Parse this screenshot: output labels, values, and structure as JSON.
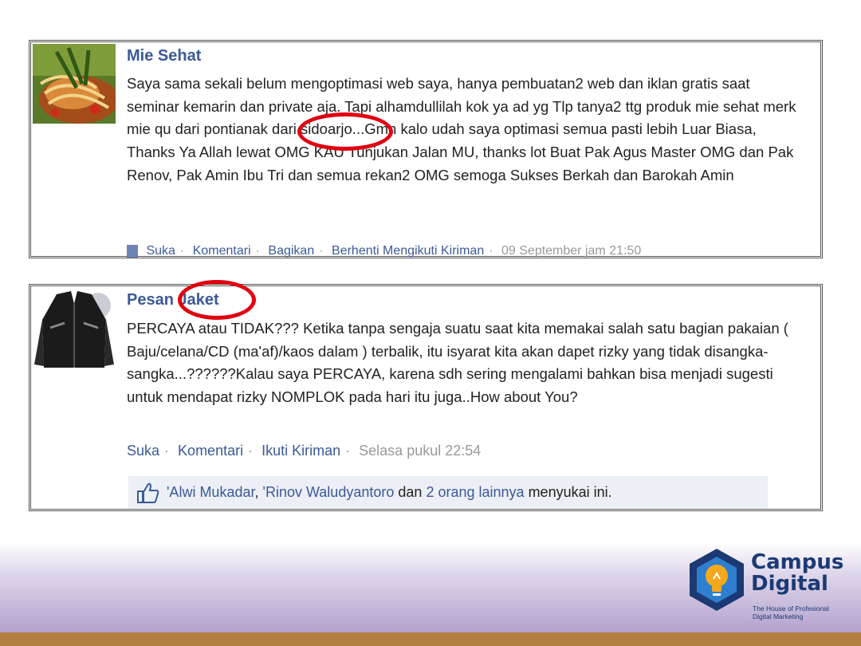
{
  "colors": {
    "link": "#3b5998",
    "annotation": "#e00010",
    "brand_blue": "#1b3a74",
    "brand_orange": "#f4a81d",
    "footer_bar": "#b07e3e"
  },
  "post1": {
    "author": "Mie Sehat",
    "avatar_icon": "noodle-photo",
    "body": "Saya sama sekali belum mengoptimasi web saya, hanya pembuatan2 web dan iklan gratis saat seminar kemarin dan private aja. Tapi alhamdullilah kok ya ad yg Tlp tanya2 ttg produk mie sehat merk mie qu dari pontianak dari sidoarjo...Gmn kalo udah saya optimasi semua pasti lebih Luar Biasa, Thanks Ya Allah lewat OMG KAU Tunjukan Jalan MU, thanks lot Buat Pak Agus Master OMG dan Pak Renov, Pak Amin Ibu Tri dan semua rekan2 OMG semoga Sukses Berkah dan Barokah Amin",
    "actions": {
      "like": "Suka",
      "comment": "Komentari",
      "share": "Bagikan",
      "follow": "Berhenti Mengikuti Kiriman",
      "time": "09 September jam 21:50"
    }
  },
  "post2": {
    "author": "Pesan Jaket",
    "avatar_icon": "jacket-photo",
    "body": "PERCAYA atau TIDAK??? Ketika tanpa sengaja suatu saat kita memakai salah satu bagian pakaian ( Baju/celana/CD (ma'af)/kaos dalam ) terbalik, itu isyarat kita akan dapet rizky yang tidak disangka-sangka...??????Kalau saya PERCAYA, karena sdh sering mengalami bahkan bisa menjadi sugesti untuk mendapat rizky NOMPLOK pada hari itu juga..How about You?",
    "actions": {
      "like": "Suka",
      "comment": "Komentari",
      "follow": "Ikuti Kiriman",
      "time": "Selasa pukul 22:54"
    },
    "likes": {
      "icon": "thumbs-up-icon",
      "person1": "'Alwi Mukadar",
      "comma": ",",
      "person2": "'Rinov Waludyantoro",
      "and": "dan",
      "others": "2 orang lainnya",
      "suffix": "menyukai ini."
    }
  },
  "logo": {
    "line1": "Campus",
    "line2": "Digital",
    "tagline1": "The House of Profesional",
    "tagline2": "Digital Marketing"
  }
}
